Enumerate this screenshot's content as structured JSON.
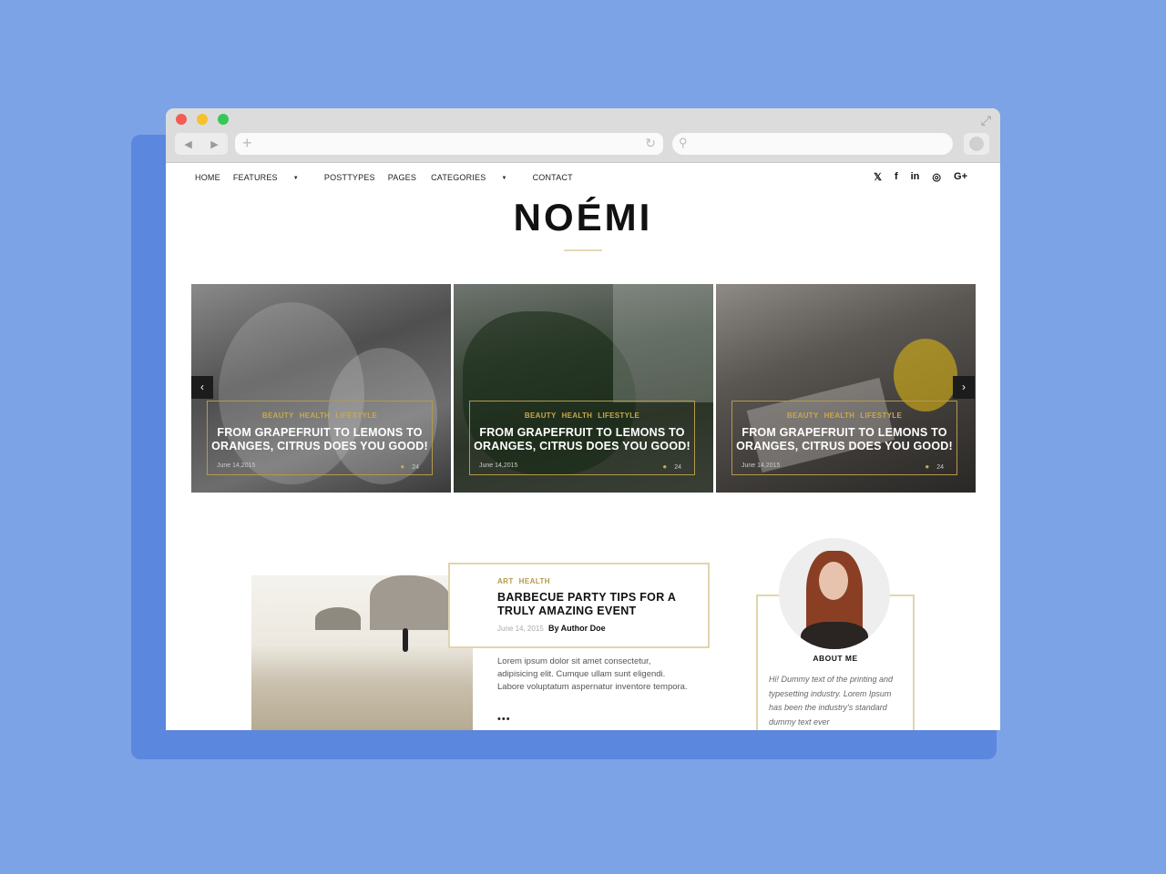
{
  "menu": {
    "items": [
      "HOME",
      "FEATURES",
      "POSTTYPES",
      "PAGES",
      "CATEGORIES",
      "CONTACT"
    ],
    "dropdown_items": [
      "FEATURES",
      "CATEGORIES"
    ]
  },
  "social": {
    "twitter": "𝕏",
    "facebook": "f",
    "linkedin": "in",
    "instagram": "◎",
    "googleplus": "G+"
  },
  "site": {
    "logo": "NOÉMI"
  },
  "slider": {
    "slides": [
      {
        "cats": [
          "BEAUTY",
          "HEALTH",
          "LIFESTYLE"
        ],
        "title": "FROM GRAPEFRUIT TO LEMONS TO ORANGES, CITRUS DOES YOU GOOD!",
        "date": "June 14,2015",
        "comments": "24"
      },
      {
        "cats": [
          "BEAUTY",
          "HEALTH",
          "LIFESTYLE"
        ],
        "title": "FROM GRAPEFRUIT TO LEMONS TO ORANGES, CITRUS DOES YOU GOOD!",
        "date": "June 14,2015",
        "comments": "24"
      },
      {
        "cats": [
          "BEAUTY",
          "HEALTH",
          "LIFESTYLE"
        ],
        "title": "FROM GRAPEFRUIT TO LEMONS TO ORANGES, CITRUS DOES YOU GOOD!",
        "date": "June 14,2015",
        "comments": "24"
      }
    ],
    "prev": "‹",
    "next": "›"
  },
  "post": {
    "cats": [
      "ART",
      "HEALTH"
    ],
    "title": "BARBECUE PARTY TIPS FOR A TRULY AMAZING EVENT",
    "date": "June 14, 2015",
    "author": "By Author Doe",
    "excerpt": "Lorem ipsum dolor sit amet consectetur, adipisicing elit. Cumque ullam sunt eligendi. Labore voluptatum aspernatur inventore tempora.",
    "more": "•••"
  },
  "about": {
    "title": "ABOUT ME",
    "text": "Hi! Dummy text of the printing and typesetting industry. Lorem Ipsum has been the industry's standard dummy text ever"
  },
  "colors": {
    "accent": "#c8a94c",
    "background": "#7ba3e6"
  }
}
